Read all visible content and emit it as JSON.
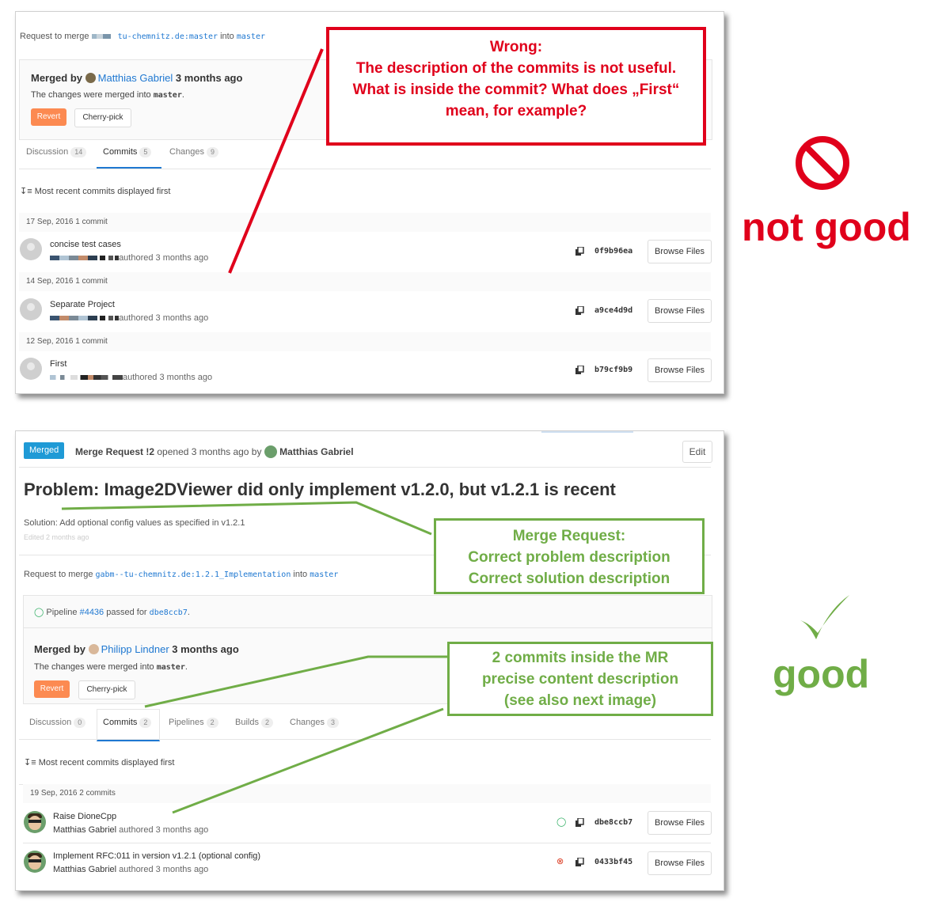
{
  "top": {
    "request_prefix": "Request to merge",
    "source_branch": "tu-chemnitz.de:master",
    "into": "into",
    "target_branch": "master",
    "merged_by_label": "Merged by",
    "merged_by_user": "Matthias Gabriel",
    "merged_time": "3 months ago",
    "merged_into_text": "The changes were merged into",
    "merged_into_branch": "master",
    "merged_into_end": ".",
    "revert_label": "Revert",
    "cherry_label": "Cherry-pick",
    "tabs": [
      {
        "label": "Discussion",
        "count": "14"
      },
      {
        "label": "Commits",
        "count": "5"
      },
      {
        "label": "Changes",
        "count": "9"
      }
    ],
    "sort_note": "Most recent commits displayed first",
    "browse_label": "Browse Files",
    "commit_groups": [
      {
        "day": "17 Sep, 2016 1 commit",
        "title": "concise test cases",
        "meta": "authored 3 months ago",
        "sha": "0f9b96ea"
      },
      {
        "day": "14 Sep, 2016 1 commit",
        "title": "Separate Project",
        "meta": "authored 3 months ago",
        "sha": "a9ce4d9d"
      },
      {
        "day": "12 Sep, 2016 1 commit",
        "title": "First",
        "meta": "authored 3 months ago",
        "sha": "b79cf9b9"
      }
    ]
  },
  "bottom": {
    "status_badge": "Merged",
    "header_mr": "Merge Request !2",
    "header_opened": "opened 3 months ago by",
    "header_user": "Matthias Gabriel",
    "edit_label": "Edit",
    "title": "Problem: Image2DViewer did only implement v1.2.0, but v1.2.1 is recent",
    "solution": "Solution: Add optional config values as specified in v1.2.1",
    "edited": "Edited 2 months ago",
    "request_prefix": "Request to merge",
    "source_branch": "gabm--tu-chemnitz.de:1.2.1_Implementation",
    "into": "into",
    "target_branch": "master",
    "pipeline_prefix": "Pipeline",
    "pipeline_id": "#4436",
    "pipeline_mid": "passed for",
    "pipeline_sha": "dbe8ccb7",
    "pipeline_end": ".",
    "merged_by_label": "Merged by",
    "merged_by_user": "Philipp Lindner",
    "merged_time": "3 months ago",
    "merged_into_text": "The changes were merged into",
    "merged_into_branch": "master",
    "merged_into_end": ".",
    "revert_label": "Revert",
    "cherry_label": "Cherry-pick",
    "tabs": [
      {
        "label": "Discussion",
        "count": "0"
      },
      {
        "label": "Commits",
        "count": "2"
      },
      {
        "label": "Pipelines",
        "count": "2"
      },
      {
        "label": "Builds",
        "count": "2"
      },
      {
        "label": "Changes",
        "count": "3"
      }
    ],
    "sort_note": "Most recent commits displayed first",
    "day": "19 Sep, 2016 2 commits",
    "browse_label": "Browse Files",
    "commits": [
      {
        "title": "Raise DioneCpp",
        "author": "Matthias Gabriel",
        "meta": "authored 3 months ago",
        "sha": "dbe8ccb7",
        "status": "passed"
      },
      {
        "title": "Implement RFC:011 in version v1.2.1 (optional config)",
        "author": "Matthias Gabriel",
        "meta": "authored 3 months ago",
        "sha": "0433bf45",
        "status": "failed"
      }
    ]
  },
  "annotations": {
    "wrong": [
      "Wrong:",
      "The description of the commits is not useful.",
      "What is inside the commit? What does „First“",
      "mean, for example?"
    ],
    "not_good": "not good",
    "mr_note": [
      "Merge Request:",
      "Correct problem description",
      "Correct solution description"
    ],
    "commits_note": [
      "2 commits inside the MR",
      "precise content description",
      "(see also next image)"
    ],
    "good": "good",
    "red_color": "#e0001b",
    "green_color": "#70ad47"
  }
}
